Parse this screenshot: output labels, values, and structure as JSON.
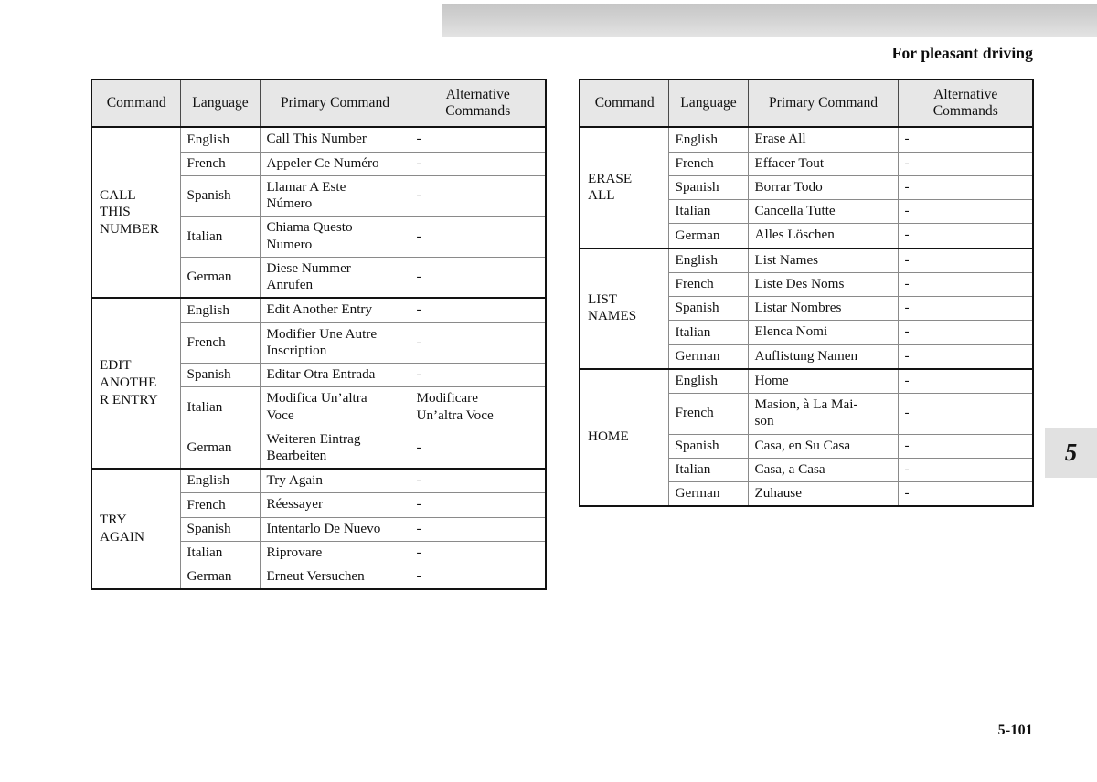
{
  "header": {
    "title": "For pleasant driving"
  },
  "chapter_tab": {
    "number": "5"
  },
  "footer": {
    "page_number": "5-101"
  },
  "table_columns": [
    "Command",
    "Language",
    "Primary Command",
    "Alternative\nCommands"
  ],
  "left_table": {
    "columns": [
      "Command",
      "Language",
      "Primary Command",
      "Alternative\nCommands"
    ],
    "groups": [
      {
        "command": "CALL\nTHIS\nNUMBER",
        "rows": [
          {
            "language": "English",
            "primary": "Call This Number",
            "alternative": "-"
          },
          {
            "language": "French",
            "primary": "Appeler Ce Numéro",
            "alternative": "-"
          },
          {
            "language": "Spanish",
            "primary": "Llamar A Este\nNúmero",
            "alternative": "-"
          },
          {
            "language": "Italian",
            "primary": "Chiama Questo\nNumero",
            "alternative": "-"
          },
          {
            "language": "German",
            "primary": "Diese Nummer\nAnrufen",
            "alternative": "-"
          }
        ]
      },
      {
        "command": "EDIT\nANOTHE\nR ENTRY",
        "rows": [
          {
            "language": "English",
            "primary": "Edit Another Entry",
            "alternative": "-"
          },
          {
            "language": "French",
            "primary": "Modifier Une Autre\nInscription",
            "alternative": "-"
          },
          {
            "language": "Spanish",
            "primary": "Editar Otra Entrada",
            "alternative": "-"
          },
          {
            "language": "Italian",
            "primary": "Modifica Un’altra\nVoce",
            "alternative": "Modificare\nUn’altra Voce"
          },
          {
            "language": "German",
            "primary": "Weiteren Eintrag\nBearbeiten",
            "alternative": "-"
          }
        ]
      },
      {
        "command": "TRY\nAGAIN",
        "rows": [
          {
            "language": "English",
            "primary": "Try Again",
            "alternative": "-"
          },
          {
            "language": "French",
            "primary": "Réessayer",
            "alternative": "-"
          },
          {
            "language": "Spanish",
            "primary": "Intentarlo De Nuevo",
            "alternative": "-"
          },
          {
            "language": "Italian",
            "primary": "Riprovare",
            "alternative": "-"
          },
          {
            "language": "German",
            "primary": "Erneut Versuchen",
            "alternative": "-"
          }
        ]
      }
    ]
  },
  "right_table": {
    "columns": [
      "Command",
      "Language",
      "Primary Command",
      "Alternative\nCommands"
    ],
    "groups": [
      {
        "command": "ERASE\nALL",
        "rows": [
          {
            "language": "English",
            "primary": "Erase All",
            "alternative": "-"
          },
          {
            "language": "French",
            "primary": "Effacer Tout",
            "alternative": "-"
          },
          {
            "language": "Spanish",
            "primary": "Borrar Todo",
            "alternative": "-"
          },
          {
            "language": "Italian",
            "primary": "Cancella Tutte",
            "alternative": "-"
          },
          {
            "language": "German",
            "primary": "Alles Löschen",
            "alternative": "-"
          }
        ]
      },
      {
        "command": "LIST\nNAMES",
        "rows": [
          {
            "language": "English",
            "primary": "List Names",
            "alternative": "-"
          },
          {
            "language": "French",
            "primary": "Liste Des Noms",
            "alternative": "-"
          },
          {
            "language": "Spanish",
            "primary": "Listar Nombres",
            "alternative": "-"
          },
          {
            "language": "Italian",
            "primary": "Elenca Nomi",
            "alternative": "-"
          },
          {
            "language": "German",
            "primary": "Auflistung Namen",
            "alternative": "-"
          }
        ]
      },
      {
        "command": "HOME",
        "rows": [
          {
            "language": "English",
            "primary": "Home",
            "alternative": "-"
          },
          {
            "language": "French",
            "primary": "Masion, à La Mai-\nson",
            "alternative": "-"
          },
          {
            "language": "Spanish",
            "primary": "Casa, en Su Casa",
            "alternative": "-"
          },
          {
            "language": "Italian",
            "primary": "Casa, a Casa",
            "alternative": "-"
          },
          {
            "language": "German",
            "primary": "Zuhause",
            "alternative": "-"
          }
        ]
      }
    ]
  }
}
